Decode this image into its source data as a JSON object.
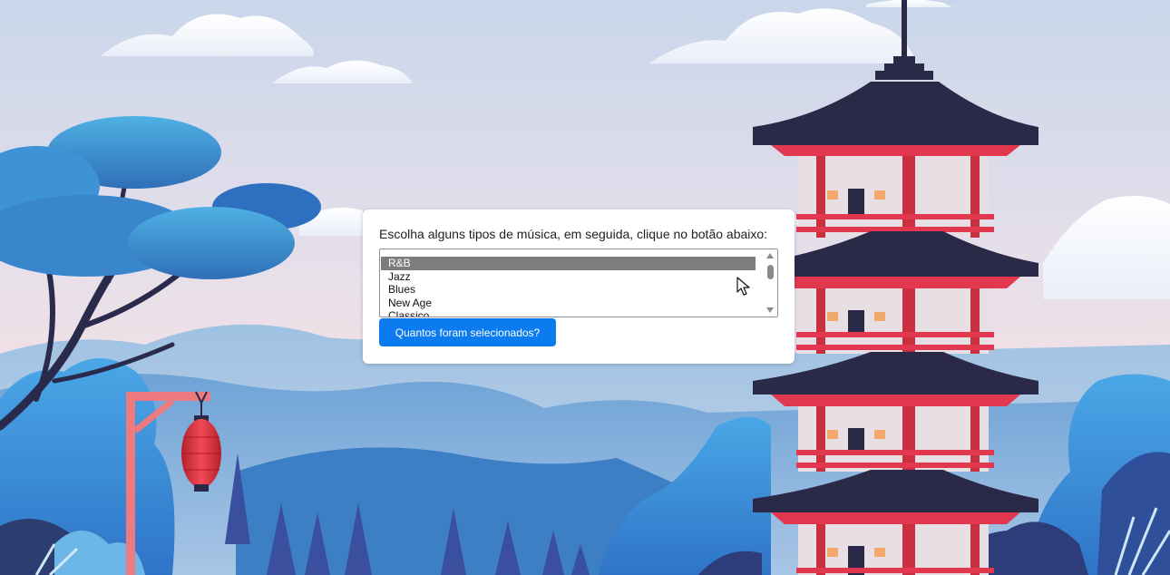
{
  "form": {
    "prompt": "Escolha alguns tipos de música, em seguida, clique no botão abaixo:",
    "options": [
      {
        "label": "R&B",
        "selected": true
      },
      {
        "label": "Jazz",
        "selected": false
      },
      {
        "label": "Blues",
        "selected": false
      },
      {
        "label": "New Age",
        "selected": false
      },
      {
        "label": "Classico",
        "selected": false
      }
    ],
    "button_label": "Quantos foram selecionados?"
  },
  "colors": {
    "button": "#0b7bef",
    "selected_option": "#7d7d7d",
    "pagoda_roof": "#2a2a48",
    "pagoda_red": "#e2384f",
    "lantern": "#e0333f"
  },
  "icons": [
    "pointer-cursor-icon"
  ]
}
